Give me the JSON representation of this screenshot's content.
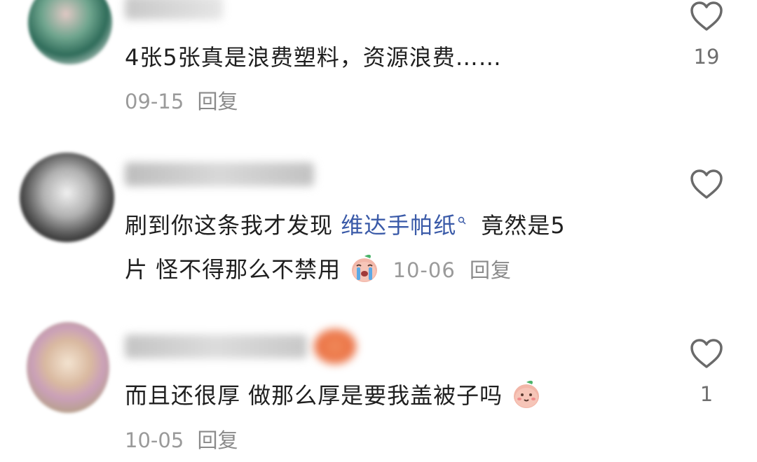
{
  "comments": [
    {
      "text": "4张5张真是浪费塑料，资源浪费……",
      "date": "09-15",
      "reply_label": "回复",
      "like_count": "19"
    },
    {
      "text_part1": "刷到你这条我才发现 ",
      "link_text": "维达手帕纸",
      "text_part2": " 竟然是5",
      "text_line2": "片 怪不得那么不禁用",
      "date": "10-06",
      "reply_label": "回复",
      "like_count": ""
    },
    {
      "text": "而且还很厚  做那么厚是要我盖被子吗",
      "date": "10-05",
      "reply_label": "回复",
      "like_count": "1"
    }
  ],
  "icons": {
    "like": "heart-outline-icon",
    "search": "search-icon",
    "emoji_crying": "crying-peach-emoji",
    "emoji_smile": "smiling-peach-emoji"
  },
  "colors": {
    "link": "#3a5aa8",
    "meta": "#9a9a9a",
    "text": "#1f1f1f"
  }
}
